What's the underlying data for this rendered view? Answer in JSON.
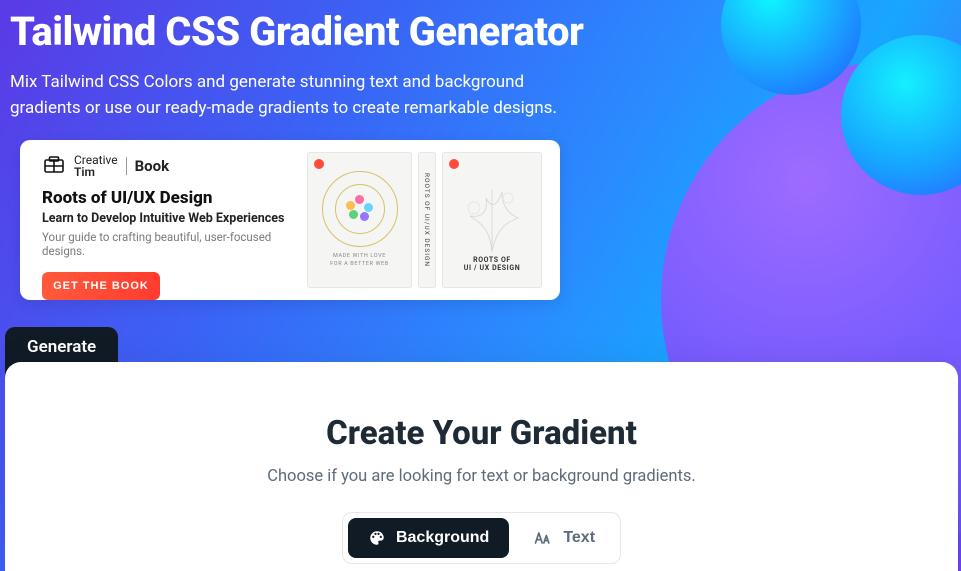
{
  "hero": {
    "title": "Tailwind CSS Gradient Generator",
    "subtitle": "Mix Tailwind CSS Colors and generate stunning text and background gradients or use our ready-made gradients to create remarkable designs."
  },
  "promo": {
    "brand_top": "Creative",
    "brand_bottom": "Tim",
    "brand_book": "Book",
    "title": "Roots of UI/UX Design",
    "subtitle": "Learn to Develop Intuitive Web Experiences",
    "description": "Your guide to crafting beautiful, user-focused designs.",
    "cta": "GET THE  BOOK",
    "open_caption_line1": "MADE WITH LOVE",
    "open_caption_line2": "FOR A BETTER WEB",
    "spine_text": "ROOTS OF UI/UX DESIGN",
    "back_title": "ROOTS OF\nUI / UX DESIGN"
  },
  "tabs": {
    "generate": "Generate"
  },
  "card": {
    "heading": "Create Your Gradient",
    "description": "Choose if you are looking for text or background gradients.",
    "option_background": "Background",
    "option_text": "Text"
  }
}
